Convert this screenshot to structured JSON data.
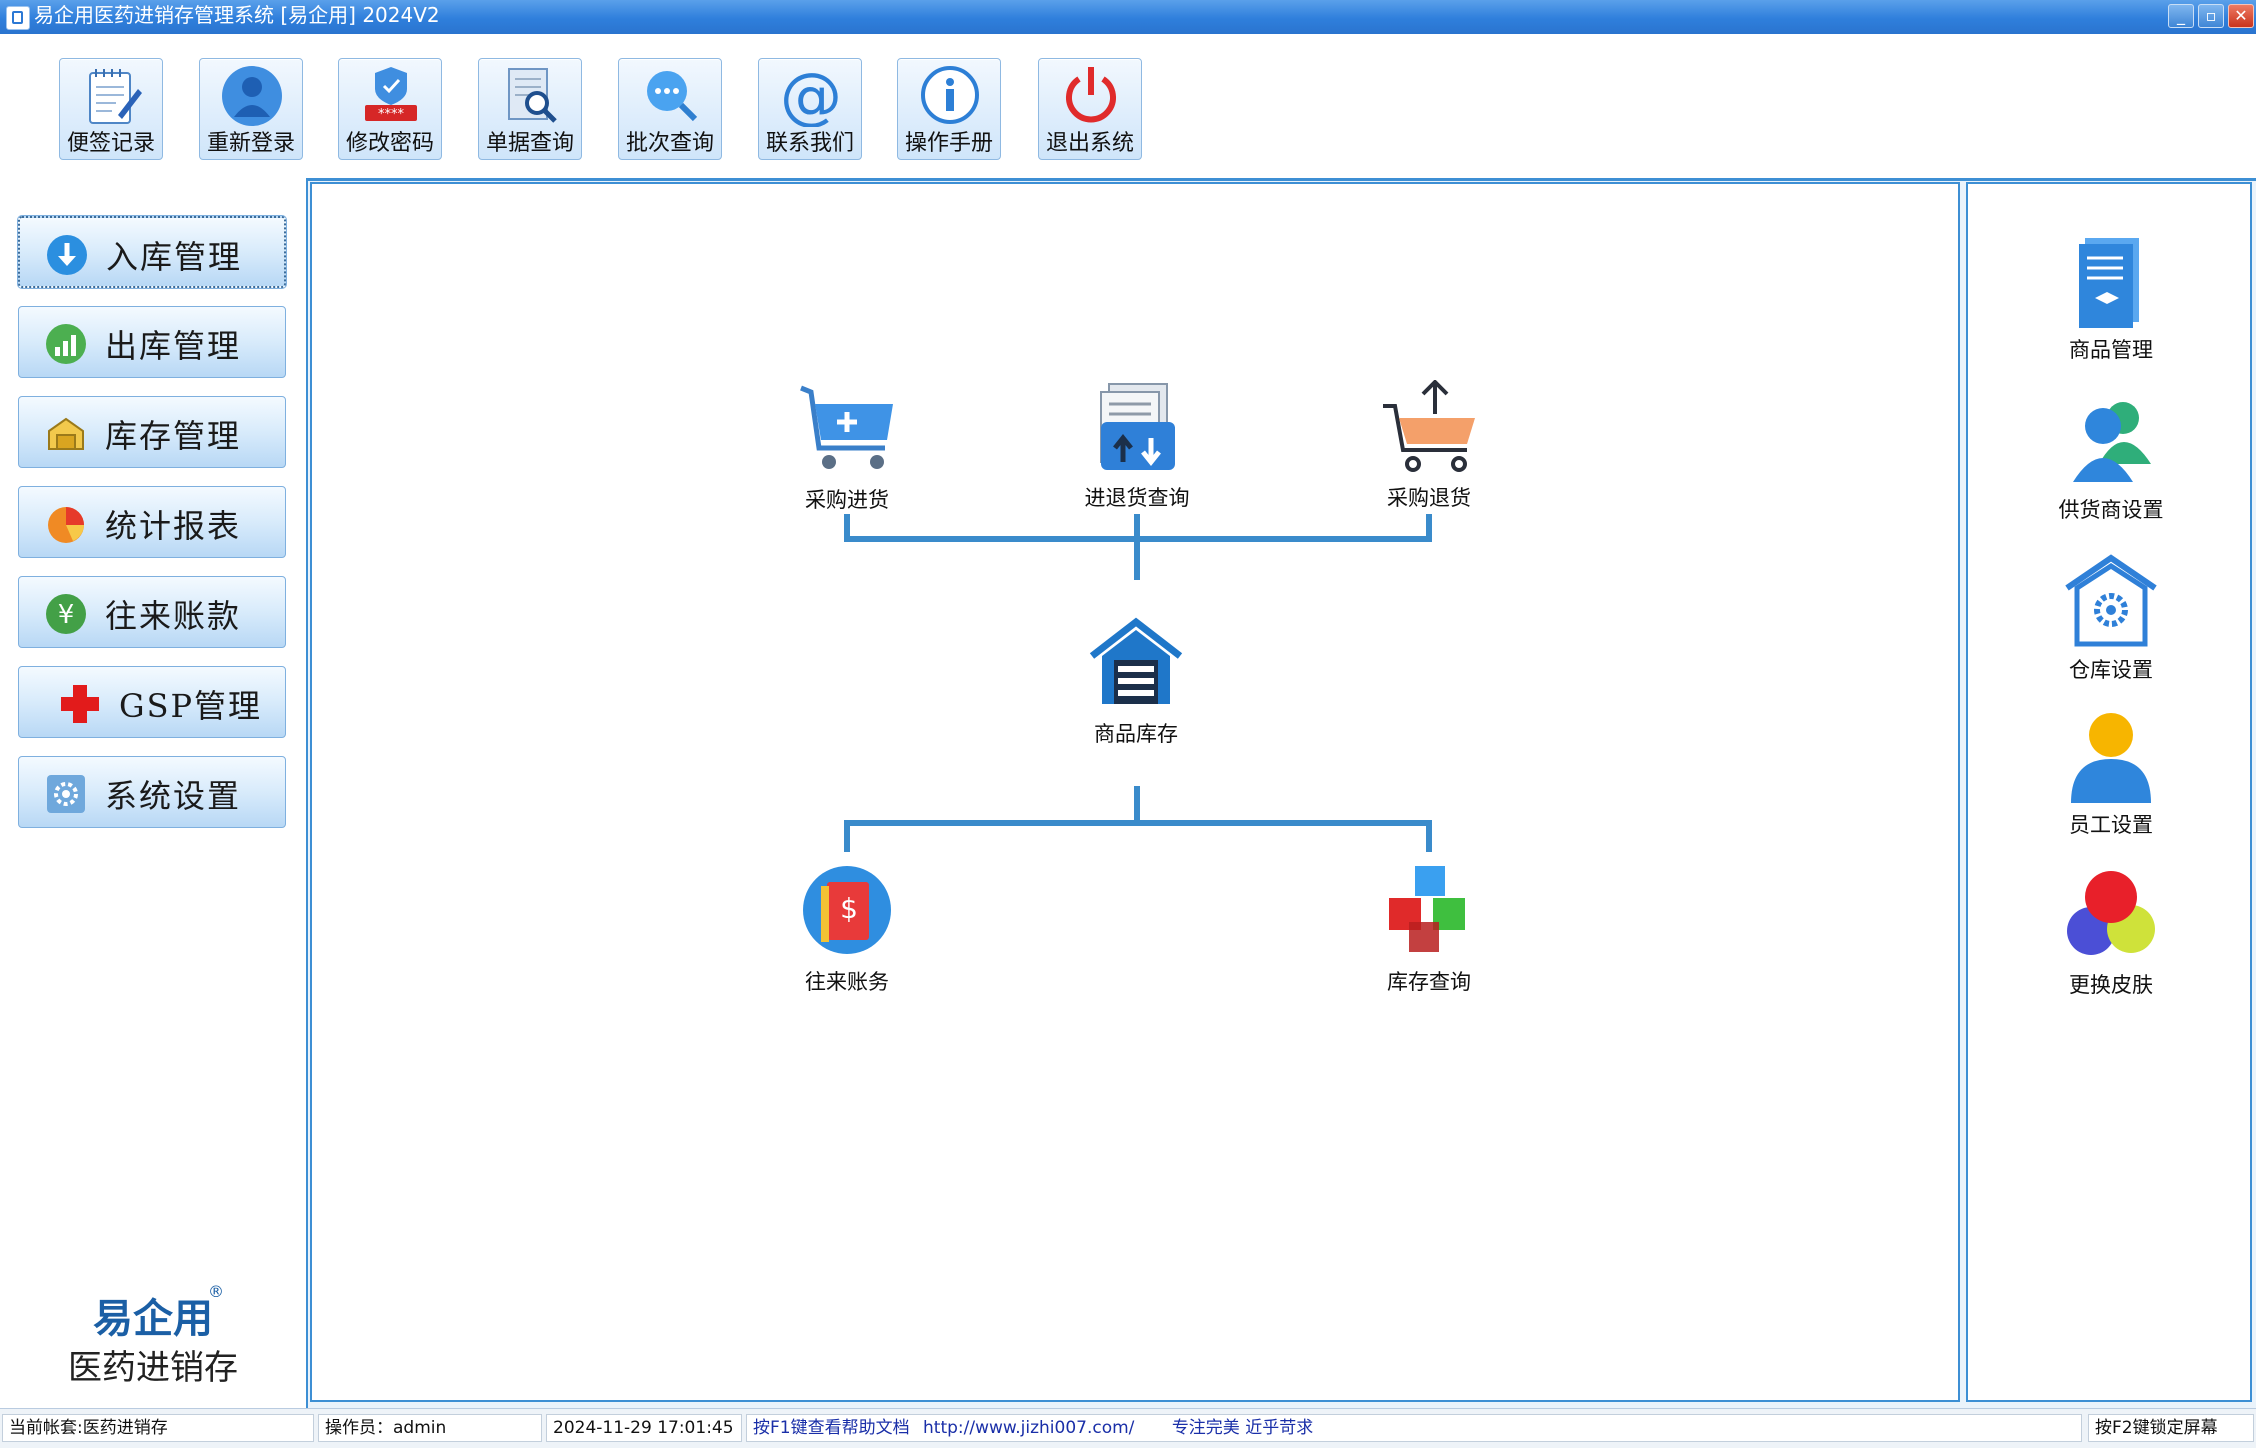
{
  "window": {
    "title": "易企用医药进销存管理系统 [易企用] 2024V2",
    "minimize": "_",
    "restore": "▫",
    "close": "✕"
  },
  "toolbar": {
    "buttons": [
      {
        "label": "便签记录",
        "icon": "notepad-icon"
      },
      {
        "label": "重新登录",
        "icon": "user-icon"
      },
      {
        "label": "修改密码",
        "icon": "password-shield-icon"
      },
      {
        "label": "单据查询",
        "icon": "document-search-icon"
      },
      {
        "label": "批次查询",
        "icon": "chat-search-icon"
      },
      {
        "label": "联系我们",
        "icon": "at-icon"
      },
      {
        "label": "操作手册",
        "icon": "info-icon"
      },
      {
        "label": "退出系统",
        "icon": "power-icon"
      }
    ]
  },
  "nav": {
    "items": [
      {
        "label": "入库管理",
        "icon": "download-arrow-icon"
      },
      {
        "label": "出库管理",
        "icon": "bar-chart-up-icon"
      },
      {
        "label": "库存管理",
        "icon": "warehouse-box-icon"
      },
      {
        "label": "统计报表",
        "icon": "pie-chart-icon"
      },
      {
        "label": "往来账款",
        "icon": "yen-icon"
      },
      {
        "label": "GSP管理",
        "icon": "red-cross-icon"
      },
      {
        "label": "系统设置",
        "icon": "gear-icon"
      }
    ]
  },
  "brand": {
    "name": "易企用",
    "reg": "®",
    "subtitle": "医药进销存"
  },
  "flow": {
    "purchase_in": "采购进货",
    "in_out_query": "进退货查询",
    "purchase_return": "采购退货",
    "inventory": "商品库存",
    "accounts": "往来账务",
    "stock_query": "库存查询"
  },
  "side": {
    "items": [
      {
        "label": "商品管理",
        "icon": "product-docs-icon"
      },
      {
        "label": "供货商设置",
        "icon": "supplier-people-icon"
      },
      {
        "label": "仓库设置",
        "icon": "warehouse-gear-icon"
      },
      {
        "label": "员工设置",
        "icon": "employee-icon"
      },
      {
        "label": "更换皮肤",
        "icon": "color-circles-icon"
      }
    ]
  },
  "status": {
    "account": "当前帐套:医药进销存",
    "operator": "操作员：admin",
    "datetime": "2024-11-29 17:01:45",
    "help": "按F1键查看帮助文档",
    "url": "http://www.jizhi007.com/",
    "slogan": "专注完美 近乎苛求",
    "lock": "按F2键锁定屏幕"
  },
  "colors": {
    "accent": "#3d8fd4",
    "titlebar": "#2f7fdc",
    "connector": "#3a8bcb"
  }
}
